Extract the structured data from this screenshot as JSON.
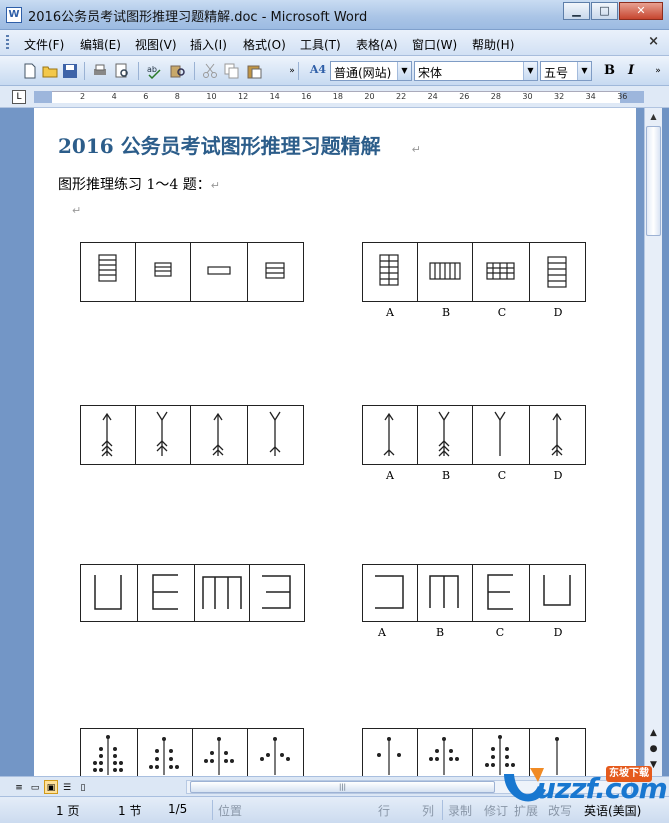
{
  "window": {
    "title": "2016公务员考试图形推理习题精解.doc - Microsoft Word",
    "app_icon": "W",
    "minimize": "▁",
    "maximize": "□",
    "close": "✕"
  },
  "menu": {
    "items": [
      "文件(F)",
      "编辑(E)",
      "视图(V)",
      "插入(I)",
      "格式(O)",
      "工具(T)",
      "表格(A)",
      "窗口(W)",
      "帮助(H)"
    ],
    "close_doc": "×"
  },
  "toolbar": {
    "style_value": "普通(网站)",
    "font_value": "宋体",
    "size_value": "五号",
    "bold_label": "B",
    "italic_label": "I",
    "style_icon_label": "A4",
    "overflow_label": "»"
  },
  "ruler": {
    "tab_selector": "L",
    "ticks": [
      "2",
      "4",
      "6",
      "8",
      "10",
      "12",
      "14",
      "16",
      "18",
      "20",
      "22",
      "24",
      "26",
      "28",
      "30",
      "32",
      "34",
      "36"
    ]
  },
  "document": {
    "title": "2016 公务员考试图形推理习题精解",
    "subtitle": "图形推理练习 1～4 题：",
    "para_mark": "↵",
    "option_labels": [
      "A",
      "B",
      "C",
      "D"
    ]
  },
  "statusbar": {
    "page": "1 页",
    "section": "1 节",
    "page_of": "1/5",
    "position": "位置",
    "line": "行",
    "column": "列",
    "record": "录制",
    "revise": "修订",
    "extend": "扩展",
    "overwrite": "改写",
    "language": "英语(美国)"
  },
  "watermark": {
    "brand": "uzzf.com",
    "badge": "东坡下载"
  },
  "colors": {
    "title_blue": "#2c5d8a",
    "frame_blue": "#7396c6"
  }
}
